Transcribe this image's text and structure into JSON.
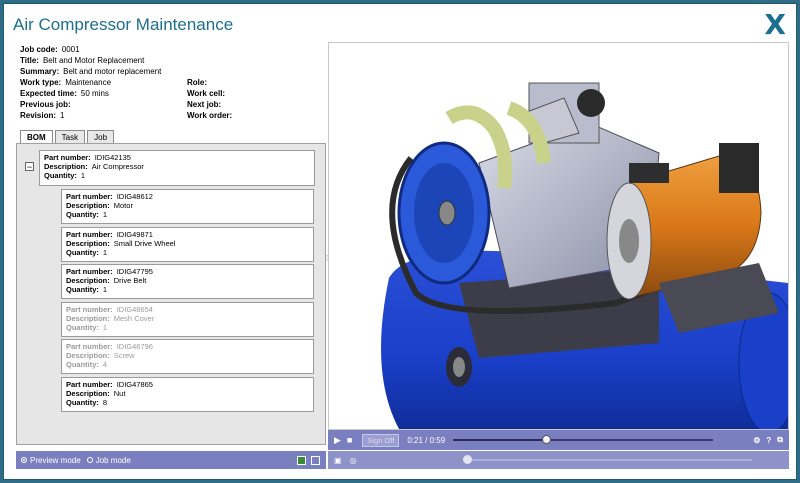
{
  "window": {
    "title": "Air Compressor Maintenance",
    "close_label": "X"
  },
  "job": {
    "left": [
      {
        "label": "Job code:",
        "value": "0001"
      },
      {
        "label": "Title:",
        "value": "Belt and Motor Replacement"
      },
      {
        "label": "Summary:",
        "value": "Belt and motor replacement"
      },
      {
        "label": "Work type:",
        "value": "Maintenance"
      },
      {
        "label": "Expected time:",
        "value": "50 mins"
      },
      {
        "label": "Previous job:",
        "value": ""
      },
      {
        "label": "Revision:",
        "value": "1"
      }
    ],
    "right": [
      {
        "label": "Role:",
        "value": ""
      },
      {
        "label": "Work cell:",
        "value": ""
      },
      {
        "label": "Next job:",
        "value": ""
      },
      {
        "label": "Work order:",
        "value": ""
      }
    ]
  },
  "tabs": [
    "BOM",
    "Task",
    "Job"
  ],
  "bom_labels": {
    "part": "Part number:",
    "desc": "Description:",
    "qty": "Quantity:"
  },
  "bom": [
    {
      "part": "IDIG42135",
      "desc": "Air Compressor",
      "qty": "1",
      "dim": false
    },
    {
      "part": "IDIG48612",
      "desc": "Motor",
      "qty": "1",
      "dim": false
    },
    {
      "part": "IDIG49871",
      "desc": "Small Drive Wheel",
      "qty": "1",
      "dim": false
    },
    {
      "part": "IDIG47795",
      "desc": "Drive Belt",
      "qty": "1",
      "dim": false
    },
    {
      "part": "IDIG48654",
      "desc": "Mesh Cover",
      "qty": "1",
      "dim": true
    },
    {
      "part": "IDIG46796",
      "desc": "Screw",
      "qty": "4",
      "dim": true
    },
    {
      "part": "IDIG47865",
      "desc": "Nut",
      "qty": "8",
      "dim": false
    }
  ],
  "modes": {
    "preview": "Preview mode",
    "job": "Job mode"
  },
  "player": {
    "signoff": "Sign Off",
    "time": "0:21 / 0:59",
    "progress": 0.356
  }
}
